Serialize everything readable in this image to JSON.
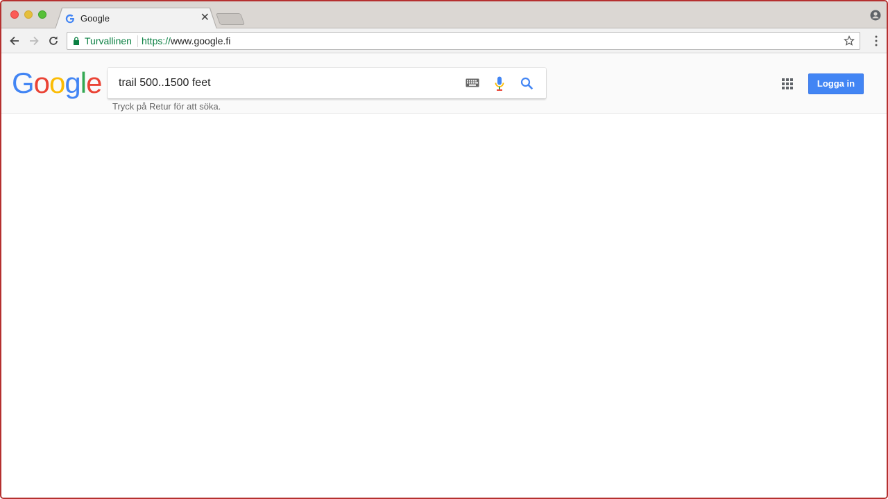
{
  "browser": {
    "tab": {
      "title": "Google"
    },
    "omnibox": {
      "secure_label": "Turvallinen",
      "url_scheme": "https://",
      "url_host": "www.google.fi"
    }
  },
  "google": {
    "logo_letters": [
      {
        "ch": "G",
        "color": "#4285f4"
      },
      {
        "ch": "o",
        "color": "#ea4335"
      },
      {
        "ch": "o",
        "color": "#fbbc05"
      },
      {
        "ch": "g",
        "color": "#4285f4"
      },
      {
        "ch": "l",
        "color": "#34a853"
      },
      {
        "ch": "e",
        "color": "#ea4335"
      }
    ],
    "search_query": "trail 500..1500 feet",
    "hint": "Tryck på Retur för att söka.",
    "signin_label": "Logga in"
  },
  "colors": {
    "accent_blue": "#4285f4",
    "secure_green": "#0b8043"
  }
}
